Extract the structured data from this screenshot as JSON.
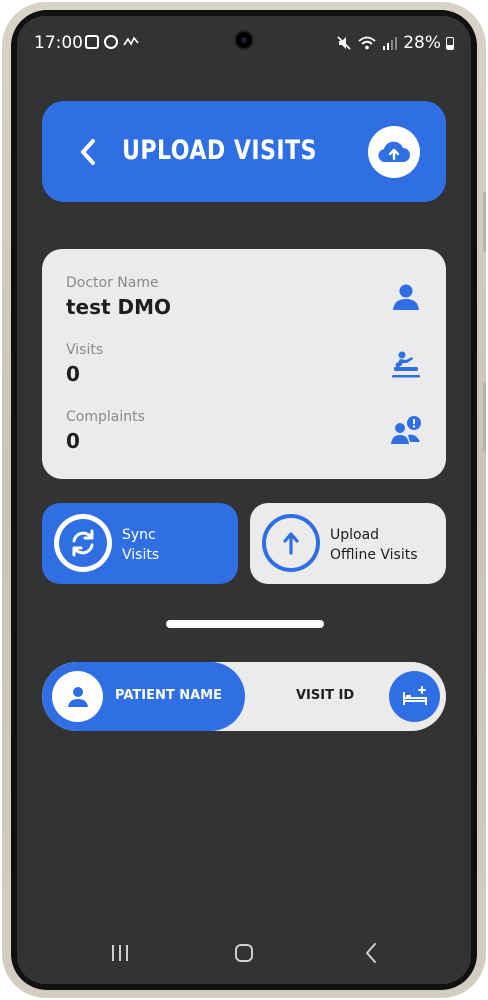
{
  "status_bar": {
    "time": "17:00",
    "battery": "28%"
  },
  "header": {
    "title": "UPLOAD VISITS"
  },
  "info_card": {
    "doctor_label": "Doctor Name",
    "doctor_value": "test DMO",
    "visits_label": "Visits",
    "visits_value": "0",
    "complaints_label": "Complaints",
    "complaints_value": "0"
  },
  "actions": {
    "sync_line1": "Sync",
    "sync_line2": "Visits",
    "upload_line1": "Upload",
    "upload_line2": "Offline Visits"
  },
  "tabs": {
    "patient_name": "PATIENT NAME",
    "visit_id": "VISIT ID"
  },
  "icons": {
    "header_action": "cloud-upload-icon",
    "doctor": "person-icon",
    "visits": "treatment-icon",
    "complaints": "people-alert-icon",
    "sync": "sync-icon",
    "upload": "arrow-up-icon",
    "patient": "person-icon",
    "bed": "bed-add-icon"
  },
  "colors": {
    "accent": "#2f6fe3",
    "background": "#333333",
    "card": "#ebebeb"
  }
}
